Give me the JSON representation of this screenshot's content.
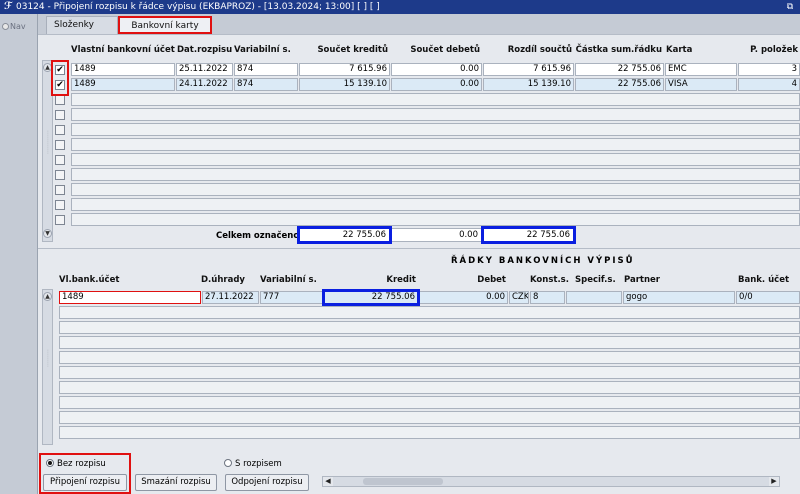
{
  "window": {
    "title": "03124 - Připojení rozpisu k řádce výpisu (EKBAPROZ) - [13.03.2024; 13:00]  [ ]  [ ]",
    "restore_icon": "restore-window-icon"
  },
  "nav": {
    "label": "Nav"
  },
  "tabs": [
    {
      "label": "Složenky"
    },
    {
      "label": "Bankovní karty"
    }
  ],
  "top_table": {
    "headers": [
      "Vlastní bankovní účet",
      "Dat.rozpisu",
      "Variabilní s.",
      "Součet kreditů",
      "Součet debetů",
      "Rozdíl součtů",
      "Částka sum.řádku",
      "Karta",
      "P. položek"
    ],
    "rows": [
      {
        "checked": true,
        "cells": [
          "1489",
          "25.11.2022",
          "874",
          "7 615.96",
          "0.00",
          "7 615.96",
          "22 755.06",
          "EMC",
          "3"
        ]
      },
      {
        "checked": true,
        "cells": [
          "1489",
          "24.11.2022",
          "874",
          "15 139.10",
          "0.00",
          "15 139.10",
          "22 755.06",
          "VISA",
          "4"
        ]
      }
    ],
    "totals": {
      "label": "Celkem označeno",
      "credit": "22 755.06",
      "debit": "0.00",
      "difference": "22 755.06"
    }
  },
  "bottom_section": {
    "title": "ŘÁDKY BANKOVNÍCH VÝPISŮ",
    "headers": [
      "Vl.bank.účet",
      "D.úhrady",
      "Variabilní s.",
      "Kredit",
      "Debet",
      "Konst.s.",
      "Specif.s.",
      "Partner",
      "Bank. účet"
    ],
    "rows": [
      {
        "cells": [
          "1489",
          "27.11.2022",
          "777",
          "22 755.06",
          "0.00",
          "CZK",
          "8",
          "",
          "gogo",
          "0/0"
        ]
      }
    ]
  },
  "options": {
    "radio_without": "Bez rozpisu",
    "radio_with": "S rozpisem",
    "selected": "Bez rozpisu"
  },
  "buttons": {
    "attach": "Připojení rozpisu",
    "delete": "Smazání rozpisu",
    "detach": "Odpojení rozpisu"
  },
  "colors": {
    "title_bar": "#1d3a8a",
    "highlight_red": "#e01010",
    "highlight_blue": "#0a1fe0",
    "selected_row": "#dbeaf6"
  }
}
